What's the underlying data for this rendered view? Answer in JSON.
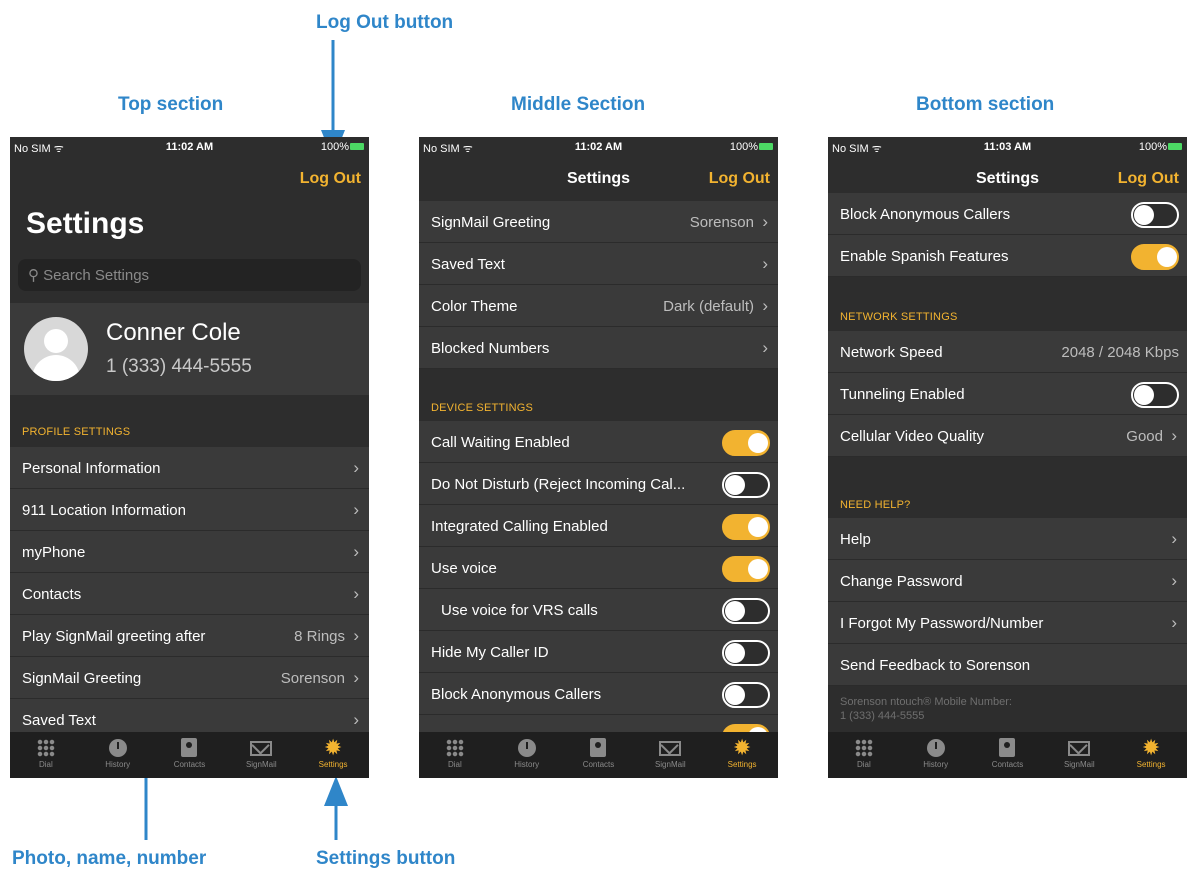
{
  "callouts": {
    "log_out_button": "Log Out button",
    "top_section": "Top section",
    "middle_section": "Middle Section",
    "bottom_section": "Bottom section",
    "photo_name_number": "Photo, name, number",
    "settings_button": "Settings button"
  },
  "colors": {
    "accent": "#f2b330",
    "background": "#2d2d2d",
    "row": "#3a3a3a",
    "callout": "#2f86c9"
  },
  "tabs": [
    {
      "label": "Dial",
      "icon": "dial-grid-icon"
    },
    {
      "label": "History",
      "icon": "history-clock-icon"
    },
    {
      "label": "Contacts",
      "icon": "contacts-book-icon"
    },
    {
      "label": "SignMail",
      "icon": "signmail-envelope-icon"
    },
    {
      "label": "Settings",
      "icon": "settings-gear-icon",
      "active": true
    }
  ],
  "screen1": {
    "status": {
      "carrier": "No SIM ᯤ",
      "time": "11:02 AM",
      "battery": "100%"
    },
    "logout": "Log Out",
    "title": "Settings",
    "search_placeholder": "Search Settings",
    "profile": {
      "name": "Conner Cole",
      "number": "1 (333) 444-5555"
    },
    "section_profile": "Profile Settings",
    "rows": [
      {
        "label": "Personal Information",
        "value": ""
      },
      {
        "label": "911 Location Information",
        "value": ""
      },
      {
        "label": "myPhone",
        "value": ""
      },
      {
        "label": "Contacts",
        "value": ""
      },
      {
        "label": "Play SignMail greeting after",
        "value": "8 Rings"
      },
      {
        "label": "SignMail Greeting",
        "value": "Sorenson"
      },
      {
        "label": "Saved Text",
        "value": ""
      }
    ]
  },
  "screen2": {
    "status": {
      "carrier": "No SIM ᯤ",
      "time": "11:02 AM",
      "battery": "100%"
    },
    "nav_title": "Settings",
    "logout": "Log Out",
    "rows": [
      {
        "label": "SignMail Greeting",
        "value": "Sorenson"
      },
      {
        "label": "Saved Text",
        "value": ""
      },
      {
        "label": "Color Theme",
        "value": "Dark (default)"
      },
      {
        "label": "Blocked Numbers",
        "value": ""
      }
    ],
    "section_device": "Device Settings",
    "toggles": [
      {
        "label": "Call Waiting Enabled",
        "on": true
      },
      {
        "label": "Do Not Disturb (Reject Incoming Cal...",
        "on": false
      },
      {
        "label": "Integrated Calling Enabled",
        "on": true
      },
      {
        "label": "Use voice",
        "on": true
      },
      {
        "label": "Use voice for VRS calls",
        "on": false
      },
      {
        "label": "Hide My Caller ID",
        "on": false
      },
      {
        "label": "Block Anonymous Callers",
        "on": false
      }
    ]
  },
  "screen3": {
    "status": {
      "carrier": "No SIM ᯤ",
      "time": "11:03 AM",
      "battery": "100%"
    },
    "nav_title": "Settings",
    "logout": "Log Out",
    "toggles_top": [
      {
        "label": "Block Anonymous Callers",
        "on": false
      },
      {
        "label": "Enable Spanish Features",
        "on": true
      }
    ],
    "section_network": "Network Settings",
    "network_speed": {
      "label": "Network Speed",
      "value": "2048 / 2048 Kbps"
    },
    "tunneling": {
      "label": "Tunneling Enabled",
      "on": false
    },
    "cellular": {
      "label": "Cellular Video Quality",
      "value": "Good"
    },
    "section_help": "Need Help?",
    "help_rows": [
      {
        "label": "Help"
      },
      {
        "label": "Change Password"
      },
      {
        "label": "I Forgot My Password/Number"
      },
      {
        "label": "Send Feedback to Sorenson"
      }
    ],
    "footer_line1": "Sorenson ntouch® Mobile Number:",
    "footer_line2": "1 (333) 444-5555"
  }
}
